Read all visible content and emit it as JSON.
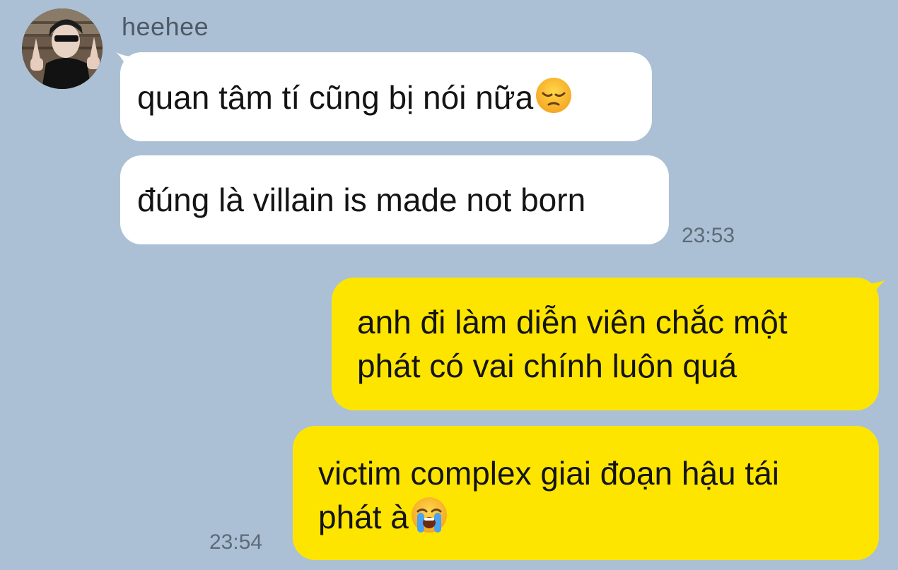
{
  "chat": {
    "sender_name": "heehee",
    "incoming": [
      {
        "text": "quan tâm tí cũng bị nói nữa",
        "emoji": "pensive-face"
      },
      {
        "text": "đúng là villain is made not born",
        "emoji": ""
      }
    ],
    "incoming_time": "23:53",
    "outgoing": [
      {
        "line1": "anh đi làm diễn viên chắc một",
        "line2": "phát có vai chính luôn quá",
        "emoji": ""
      },
      {
        "line1": "victim complex giai đoạn hậu tái",
        "line2": "phát à",
        "emoji": "loudly-crying-face"
      }
    ],
    "outgoing_time": "23:54"
  },
  "colors": {
    "background": "#abc0d4",
    "incoming_bubble": "#ffffff",
    "outgoing_bubble": "#fee500",
    "sender_text": "#4f5966",
    "time_text": "#5d6a78"
  }
}
